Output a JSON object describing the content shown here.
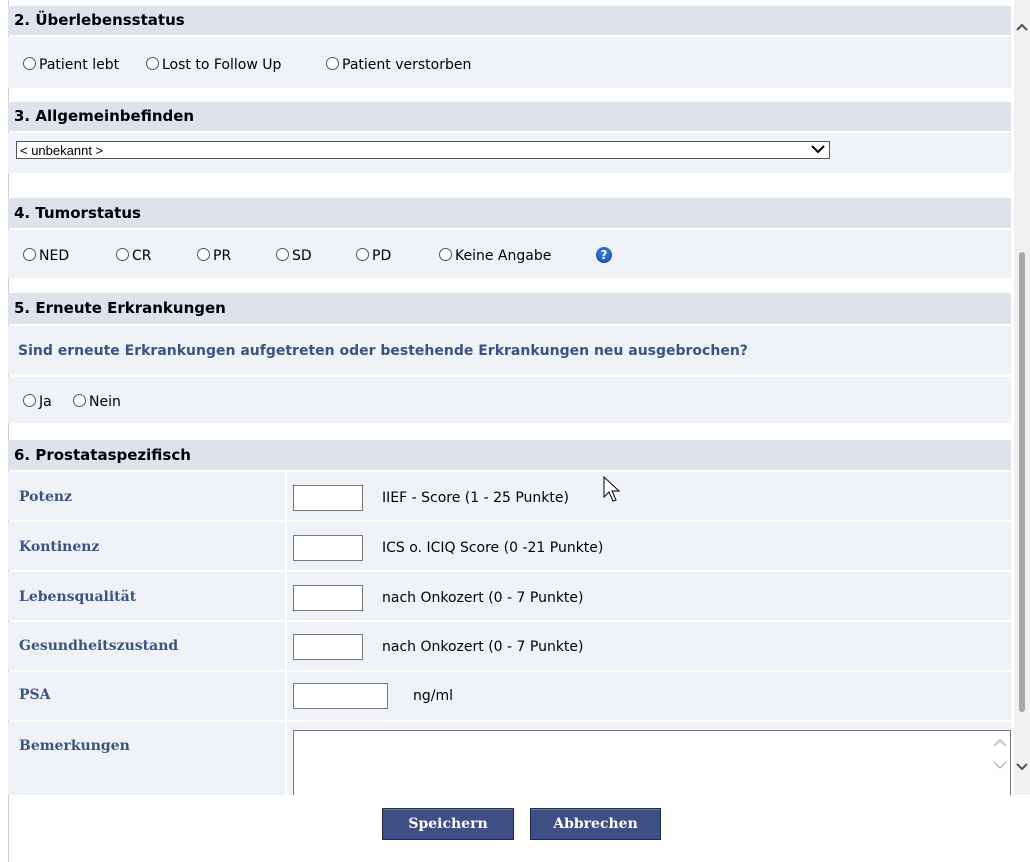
{
  "sections": {
    "survival": {
      "title": "2. Überlebensstatus",
      "options": [
        "Patient lebt",
        "Lost to Follow Up",
        "Patient verstorben"
      ]
    },
    "wellbeing": {
      "title": "3. Allgemeinbefinden",
      "select_value": "< unbekannt >"
    },
    "tumor": {
      "title": "4. Tumorstatus",
      "options": [
        "NED",
        "CR",
        "PR",
        "SD",
        "PD",
        "Keine Angabe"
      ],
      "help_icon": "help-icon"
    },
    "new_disease": {
      "title": "5. Erneute Erkrankungen",
      "question": "Sind erneute Erkrankungen aufgetreten oder bestehende Erkrankungen neu ausgebrochen?",
      "options": [
        "Ja",
        "Nein"
      ]
    },
    "prostate": {
      "title": "6. Prostataspezifisch",
      "rows": [
        {
          "label": "Potenz",
          "unit": "IIEF - Score (1 - 25 Punkte)",
          "value": ""
        },
        {
          "label": "Kontinenz",
          "unit": "ICS o. ICIQ Score (0 -21 Punkte)",
          "value": ""
        },
        {
          "label": "Lebensqualität",
          "unit": "nach Onkozert (0 - 7 Punkte)",
          "value": ""
        },
        {
          "label": "Gesundheitszustand",
          "unit": "nach Onkozert (0 - 7 Punkte)",
          "value": ""
        },
        {
          "label": "PSA",
          "unit": "ng/ml",
          "value": ""
        },
        {
          "label": "Bemerkungen",
          "value": ""
        }
      ]
    }
  },
  "buttons": {
    "save": "Speichern",
    "cancel": "Abbrechen"
  },
  "colors": {
    "header_bg": "#dde2ed",
    "body_bg": "#eff2f7",
    "label_text": "#3b5381",
    "button_bg": "#3d4f83"
  }
}
